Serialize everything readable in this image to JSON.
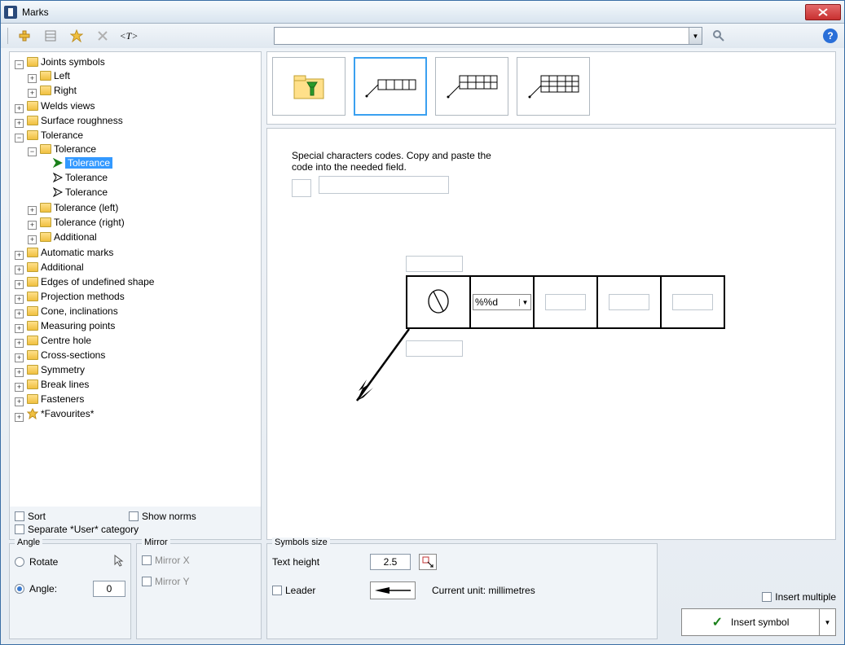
{
  "window": {
    "title": "Marks"
  },
  "toolbar": {
    "text_tool": "<T>"
  },
  "tree": {
    "root": [
      {
        "label": "Joints symbols",
        "exp": true,
        "children": [
          {
            "label": "Left",
            "exp": false
          },
          {
            "label": "Right",
            "exp": false
          }
        ]
      },
      {
        "label": "Welds views",
        "exp": false
      },
      {
        "label": "Surface roughness",
        "exp": false
      },
      {
        "label": "Tolerance",
        "exp": true,
        "children": [
          {
            "label": "Tolerance",
            "exp": true,
            "children": [
              {
                "label": "Tolerance",
                "type": "item-green",
                "selected": true
              },
              {
                "label": "Tolerance",
                "type": "item"
              },
              {
                "label": "Tolerance",
                "type": "item"
              }
            ]
          },
          {
            "label": "Tolerance (left)",
            "exp": false
          },
          {
            "label": "Tolerance (right)",
            "exp": false
          },
          {
            "label": "Additional",
            "exp": false
          }
        ]
      },
      {
        "label": "Automatic marks",
        "exp": false
      },
      {
        "label": "Additional",
        "exp": false
      },
      {
        "label": "Edges of undefined shape",
        "exp": false
      },
      {
        "label": "Projection methods",
        "exp": false
      },
      {
        "label": "Cone, inclinations",
        "exp": false
      },
      {
        "label": "Measuring points",
        "exp": false
      },
      {
        "label": "Centre hole",
        "exp": false
      },
      {
        "label": "Cross-sections",
        "exp": false
      },
      {
        "label": "Symmetry",
        "exp": false
      },
      {
        "label": "Break lines",
        "exp": false
      },
      {
        "label": "Fasteners",
        "exp": false
      },
      {
        "label": "*Favourites*",
        "exp": false,
        "icon": "star"
      }
    ]
  },
  "leftOptions": {
    "sort": "Sort",
    "show_norms": "Show norms",
    "separate_user": "Separate *User* category"
  },
  "canvas": {
    "hint": "Special characters codes. Copy and paste the code into the needed field.",
    "dropdown_value": "%%d"
  },
  "angle": {
    "title": "Angle",
    "rotate": "Rotate",
    "angle_label": "Angle:",
    "angle_value": "0"
  },
  "mirror": {
    "title": "Mirror",
    "x": "Mirror X",
    "y": "Mirror Y"
  },
  "symsize": {
    "title": "Symbols size",
    "text_height": "Text height",
    "text_height_value": "2.5",
    "leader": "Leader",
    "current_unit": "Current unit: millimetres"
  },
  "actions": {
    "insert_multiple": "Insert multiple",
    "insert_symbol": "Insert symbol"
  }
}
